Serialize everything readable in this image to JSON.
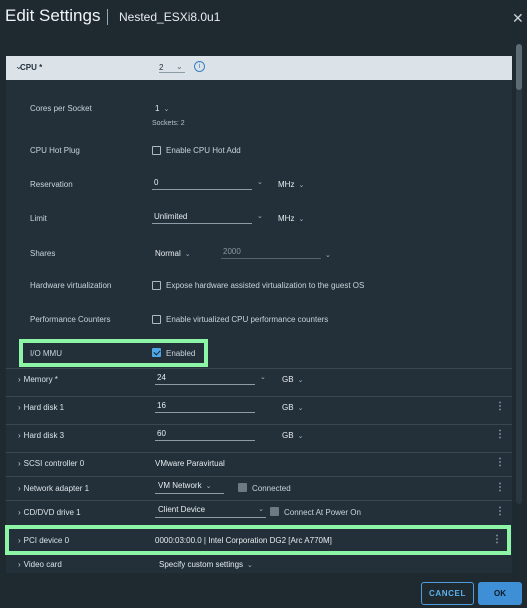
{
  "header": {
    "title": "Edit Settings",
    "vm_name": "Nested_ESXi8.0u1",
    "close_glyph": "✕"
  },
  "cpu": {
    "label": "CPU *",
    "value": "2",
    "cores_label": "Cores per Socket",
    "cores_value": "1",
    "sockets_text": "Sockets: 2",
    "hotplug_label": "CPU Hot Plug",
    "hotplug_text": "Enable CPU Hot Add",
    "reservation_label": "Reservation",
    "reservation_value": "0",
    "reservation_unit": "MHz",
    "limit_label": "Limit",
    "limit_value": "Unlimited",
    "limit_unit": "MHz",
    "shares_label": "Shares",
    "shares_value": "Normal",
    "shares_number": "2000",
    "hwvirt_label": "Hardware virtualization",
    "hwvirt_text": "Expose hardware assisted virtualization to the guest OS",
    "perfcnt_label": "Performance Counters",
    "perfcnt_text": "Enable virtualized CPU performance counters",
    "iommu_label": "I/O MMU",
    "iommu_text": "Enabled",
    "iommu_checked": true
  },
  "devices": {
    "memory": {
      "label": "Memory *",
      "value": "24",
      "unit": "GB"
    },
    "hd1": {
      "label": "Hard disk 1",
      "value": "16",
      "unit": "GB"
    },
    "hd3": {
      "label": "Hard disk 3",
      "value": "60",
      "unit": "GB"
    },
    "scsi": {
      "label": "SCSI controller 0",
      "value": "VMware Paravirtual"
    },
    "net": {
      "label": "Network adapter 1",
      "value": "VM Network",
      "check_text": "Connected"
    },
    "cd": {
      "label": "CD/DVD drive 1",
      "value": "Client Device",
      "check_text": "Connect At Power On"
    },
    "pci": {
      "label": "PCI device 0",
      "value": "0000:03:00.0 | Intel Corporation DG2 [Arc A770M]"
    },
    "video": {
      "label": "Video card",
      "value": "Specify custom settings"
    }
  },
  "footer": {
    "cancel": "CANCEL",
    "ok": "OK"
  },
  "colors": {
    "highlight": "#8cf5a6",
    "accent": "#3f8fd6",
    "panel": "#23303a"
  }
}
